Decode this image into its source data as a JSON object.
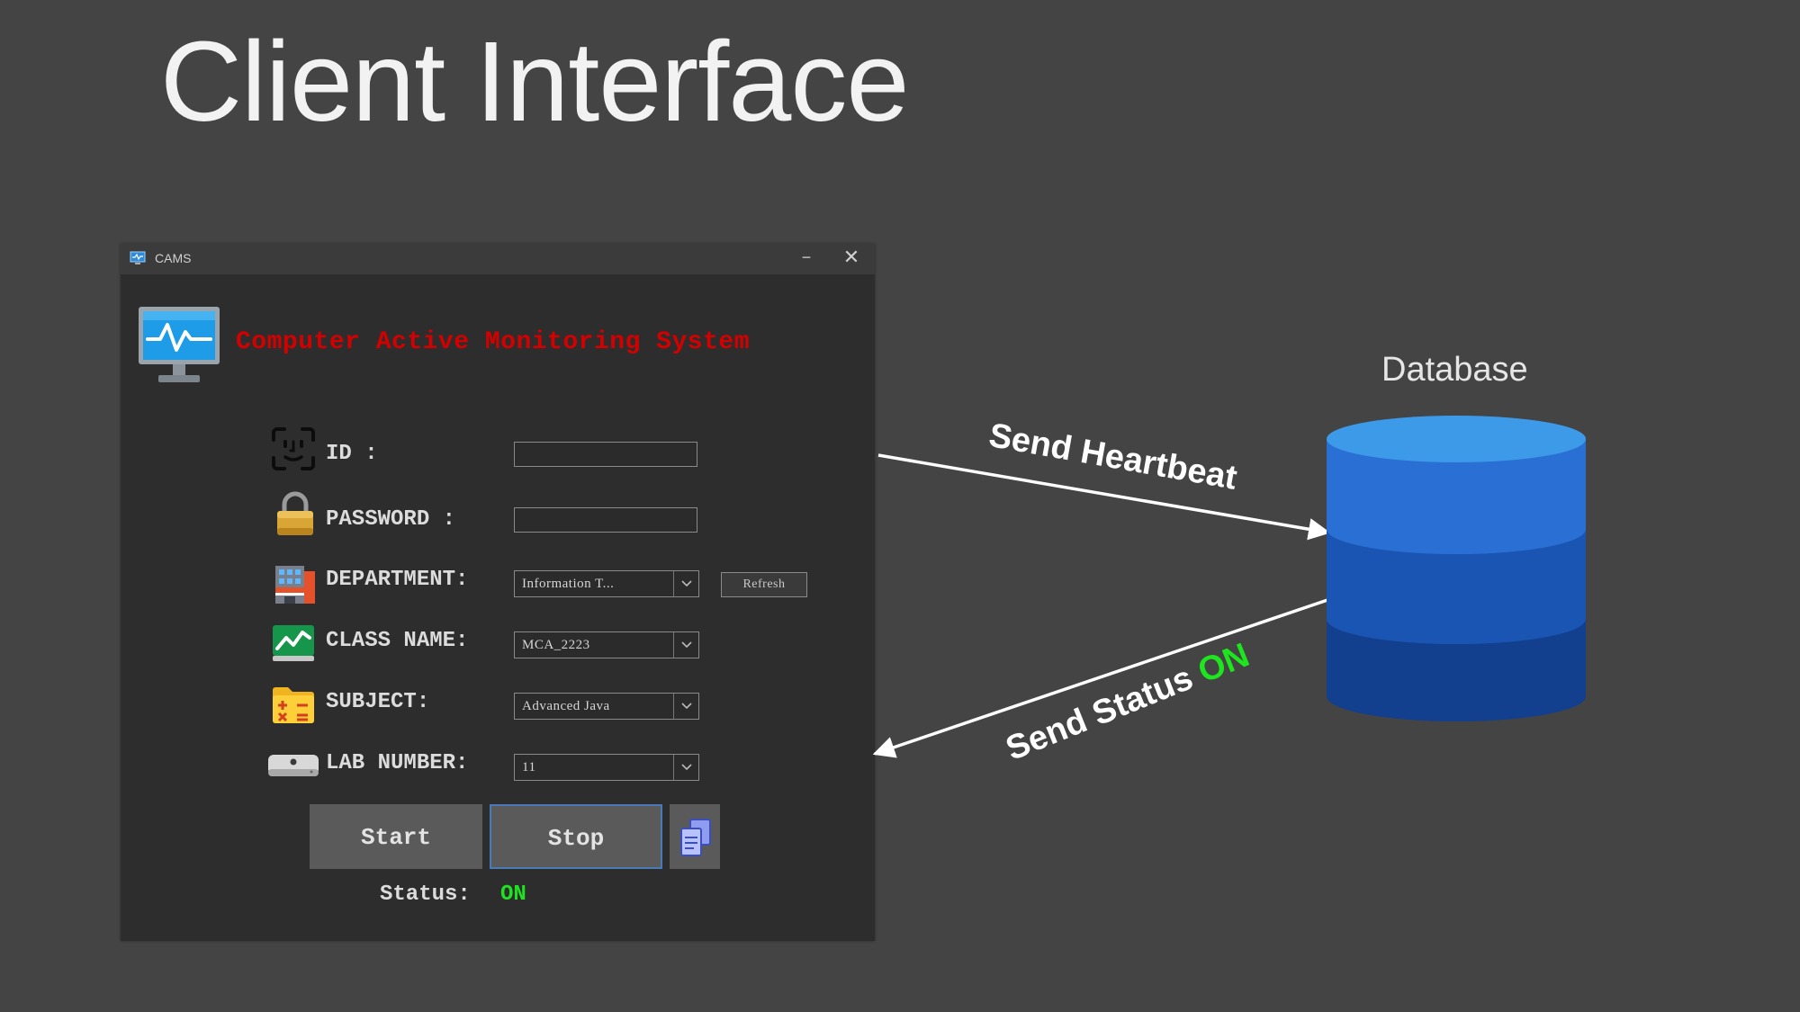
{
  "slide": {
    "title": "Client Interface"
  },
  "window": {
    "title": "CAMS",
    "minimize_glyph": "−",
    "close_glyph": "✕",
    "heading": "Computer Active Monitoring System"
  },
  "form": {
    "id": {
      "label": "ID :",
      "value": ""
    },
    "password": {
      "label": "PASSWORD :",
      "value": ""
    },
    "department": {
      "label": "DEPARTMENT:",
      "selected": "Information T..."
    },
    "class_name": {
      "label": "CLASS NAME:",
      "selected": "MCA_2223"
    },
    "subject": {
      "label": "SUBJECT:",
      "selected": "Advanced Java"
    },
    "lab_number": {
      "label": "LAB NUMBER:",
      "selected": "11"
    },
    "refresh_label": "Refresh"
  },
  "actions": {
    "start_label": "Start",
    "stop_label": "Stop"
  },
  "status": {
    "label": "Status:",
    "value": "ON",
    "value_color": "#21e021"
  },
  "diagram": {
    "database_label": "Database",
    "heartbeat_label": "Send Heartbeat",
    "status_label": "Send Status",
    "status_value": "ON"
  },
  "colors": {
    "background": "#444444",
    "heading_red": "#d40000",
    "db_top": "#3d9ae8",
    "db_body": "#2a72d4",
    "on_green": "#1ee61e"
  },
  "icons": [
    "cams-app-icon",
    "monitor-pulse-icon",
    "face-id-icon",
    "padlock-icon",
    "building-icon",
    "chart-board-icon",
    "calculator-folder-icon",
    "mac-mini-icon",
    "chevron-down-icon",
    "copy-documents-icon",
    "database-icon"
  ]
}
